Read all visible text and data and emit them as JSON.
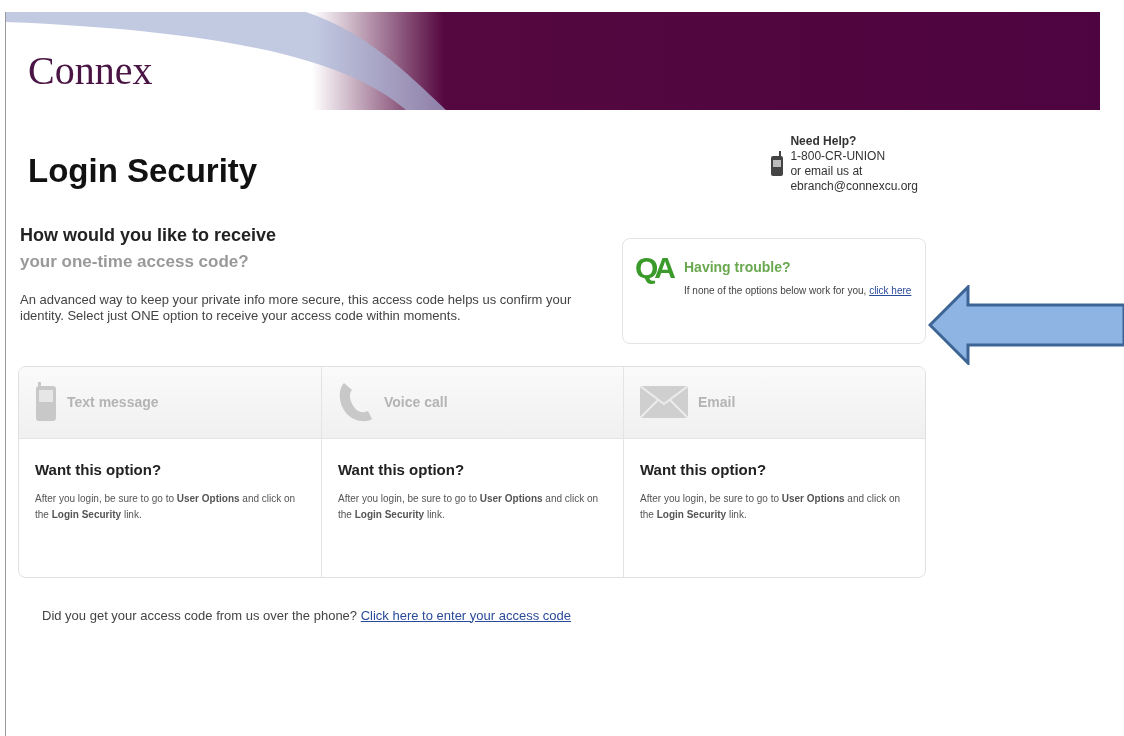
{
  "header": {
    "logo": "Connex"
  },
  "page": {
    "title": "Login Security"
  },
  "help": {
    "heading": "Need Help?",
    "phone": "1-800-CR-UNION",
    "email_prefix": "or email us at",
    "email": "ebranch@connexcu.org"
  },
  "intro": {
    "heading": "How would you like to receive",
    "subheading": "your one-time access code?",
    "text": "An advanced way to keep your private info more secure, this access code helps us confirm your identity. Select just ONE option to receive your access code within moments."
  },
  "trouble": {
    "badge": "QA",
    "heading": "Having trouble?",
    "text": "If none of the options below work for you,",
    "link": "click here"
  },
  "options": [
    {
      "kind": "text",
      "label": "Text message",
      "heading": "Want this option?",
      "text": "After you login, be sure to go to **User Options** and click on the **Login Security** link."
    },
    {
      "kind": "voice",
      "label": "Voice call",
      "heading": "Want this option?",
      "text": "After you login, be sure to go to **User Options** and click on the **Login Security** link."
    },
    {
      "kind": "email",
      "label": "Email",
      "heading": "Want this option?",
      "text": "After you login, be sure to go to **User Options** and click on the **Login Security** link."
    }
  ],
  "footer": {
    "text": "Did you get your access code from us over the phone?",
    "link": "Click here to enter your access code"
  }
}
